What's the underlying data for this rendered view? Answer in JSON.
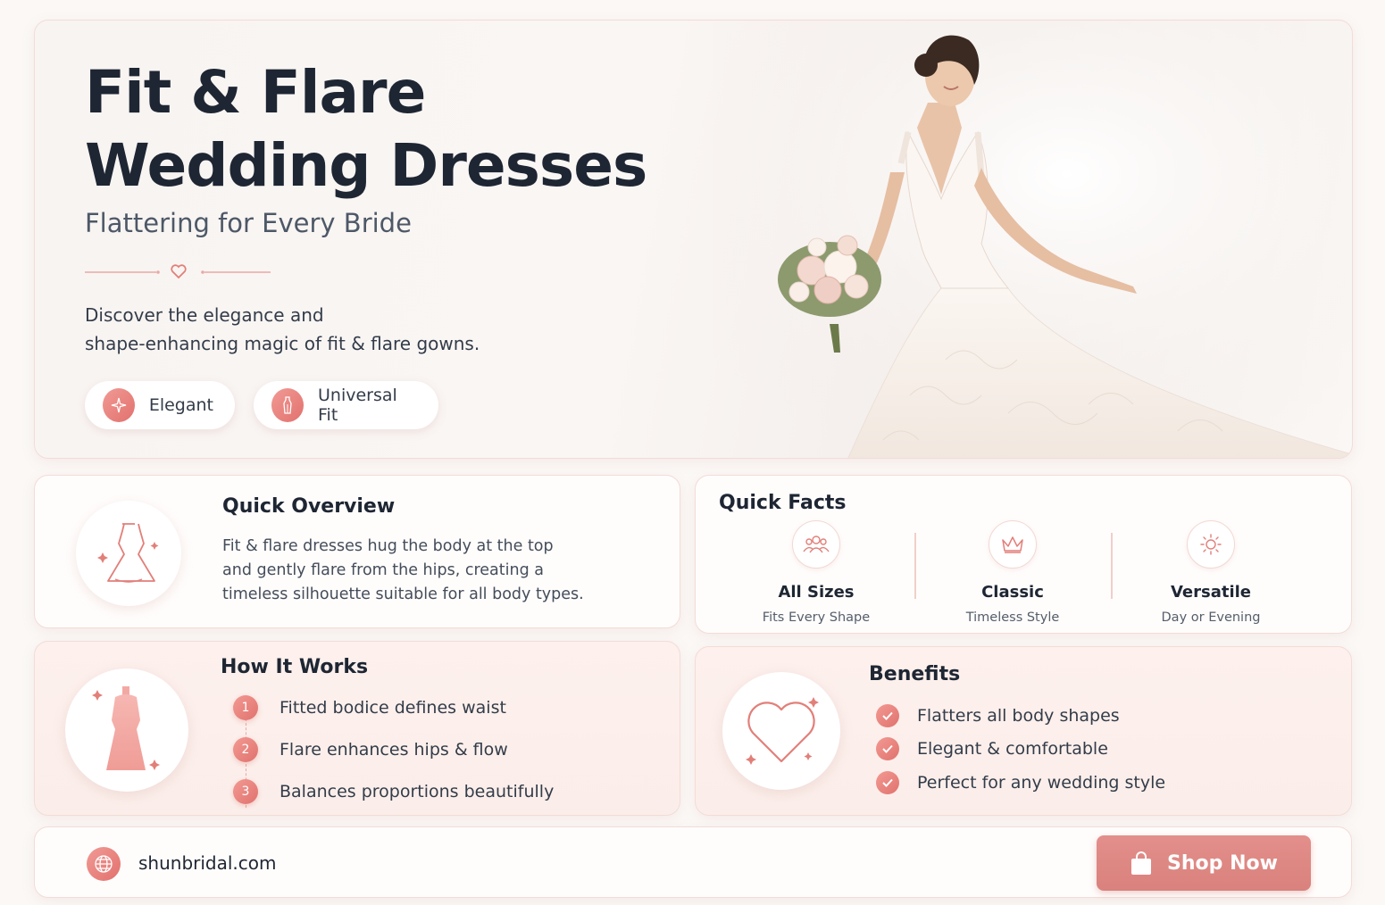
{
  "hero": {
    "title_line1": "Fit & Flare",
    "title_line2": "Wedding Dresses",
    "subtitle": "Flattering for Every Bride",
    "description_line1": "Discover the elegance and",
    "description_line2": "shape-enhancing magic of fit & flare gowns.",
    "chips": [
      {
        "label": "Elegant",
        "icon": "sparkle-icon"
      },
      {
        "label": "Universal Fit",
        "icon": "dress-form-icon"
      }
    ]
  },
  "overview": {
    "title": "Quick Overview",
    "icon": "dress-icon",
    "lines": [
      "Fit & flare dresses hug the body at the top",
      "and gently flare from the hips, creating a",
      "timeless silhouette suitable for all body types."
    ]
  },
  "facts": {
    "title": "Quick Facts",
    "items": [
      {
        "title": "All Sizes",
        "subtitle": "Fits Every Shape",
        "icon": "people-icon"
      },
      {
        "title": "Classic",
        "subtitle": "Timeless Style",
        "icon": "crown-icon"
      },
      {
        "title": "Versatile",
        "subtitle": "Day or Evening",
        "icon": "sun-moon-icon"
      }
    ]
  },
  "how": {
    "title": "How It Works",
    "icon": "dress-form-icon",
    "steps": [
      {
        "num": "1",
        "text": "Fitted bodice defines waist"
      },
      {
        "num": "2",
        "text": "Flare enhances hips & flow"
      },
      {
        "num": "3",
        "text": "Balances proportions beautifully"
      }
    ]
  },
  "benefits": {
    "title": "Benefits",
    "icon": "heart-icon",
    "items": [
      "Flatters all body shapes",
      "Elegant & comfortable",
      "Perfect for any wedding style"
    ]
  },
  "footer": {
    "site": "shunbridal.com",
    "cta": "Shop Now",
    "icon": "globe-icon",
    "cta_icon": "shopping-bag-icon"
  },
  "colors": {
    "accent": "#e0726d",
    "title": "#1e2633",
    "card_pink": "#fdf0ed",
    "button": "#dc8581"
  }
}
